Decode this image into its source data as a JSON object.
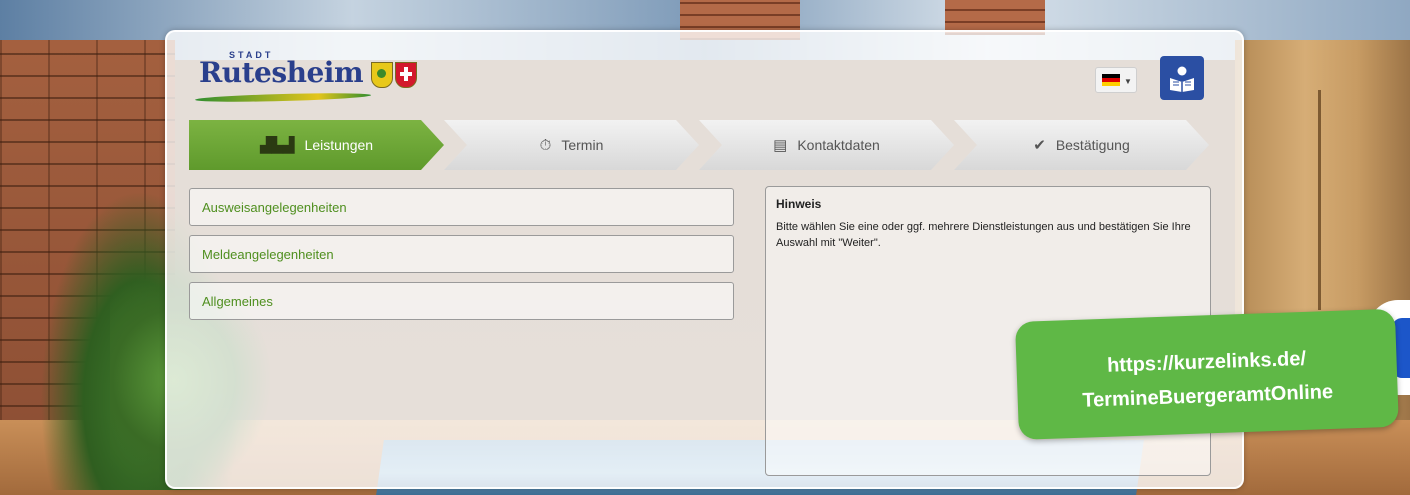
{
  "logo": {
    "stadt": "STADT",
    "name": "Rutesheim"
  },
  "language": {
    "selected_flag": "de-flag"
  },
  "easy_read": {
    "icon": "easy-read-icon"
  },
  "steps": [
    {
      "label": "Leistungen",
      "icon": "factory-icon",
      "active": true
    },
    {
      "label": "Termin",
      "icon": "clock-icon",
      "active": false
    },
    {
      "label": "Kontaktdaten",
      "icon": "id-card-icon",
      "active": false
    },
    {
      "label": "Bestätigung",
      "icon": "check-icon",
      "active": false
    }
  ],
  "services": [
    {
      "label": "Ausweisangelegenheiten"
    },
    {
      "label": "Meldeangelegenheiten"
    },
    {
      "label": "Allgemeines"
    }
  ],
  "info": {
    "title": "Hinweis",
    "text": "Bitte wählen Sie eine oder ggf. mehrere Dienstleistungen aus und bestätigen Sie Ihre Auswahl mit \"Weiter\"."
  },
  "link_badge": {
    "line1": "https://kurzelinks.de/",
    "line2": "TermineBuergeramtOnline"
  },
  "colors": {
    "accent_green": "#6aa638",
    "service_text": "#4f8f1f",
    "badge_green": "#5fb846",
    "easy_read_blue": "#2b4fa3"
  }
}
